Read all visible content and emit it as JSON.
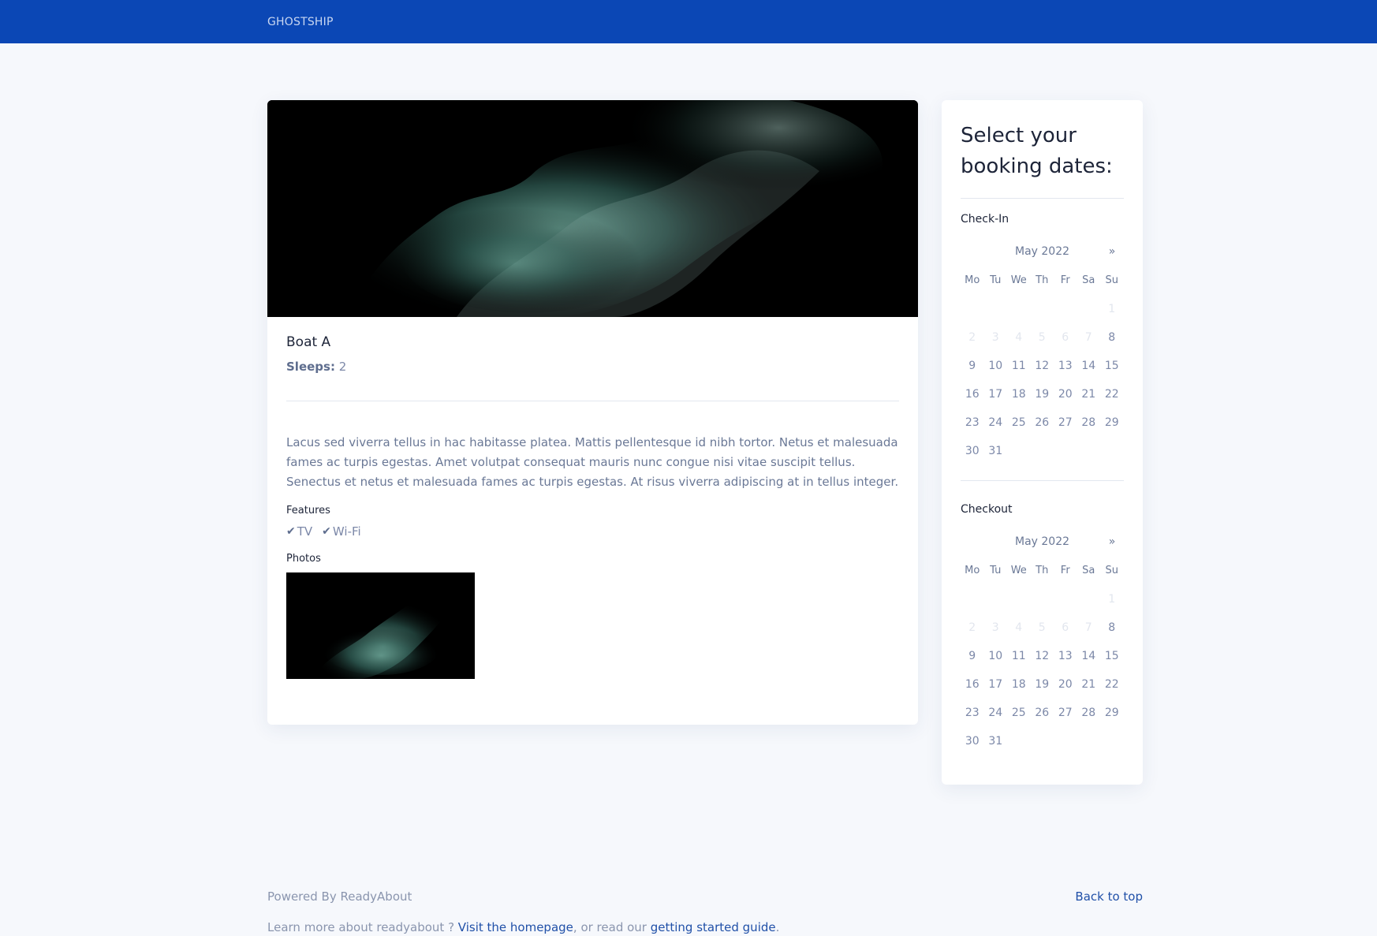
{
  "header": {
    "brand": "GHOSTSHIP"
  },
  "listing": {
    "title": "Boat A",
    "sleeps_label": "Sleeps:",
    "sleeps_value": "2",
    "description": "Lacus sed viverra tellus in hac habitasse platea. Mattis pellentesque id nibh tortor. Netus et malesuada fames ac turpis egestas. Amet volutpat consequat mauris nunc congue nisi vitae suscipit tellus. Senectus et netus et malesuada fames ac turpis egestas. At risus viverra adipiscing at in tellus integer.",
    "features_label": "Features",
    "features": [
      "TV",
      "Wi-Fi"
    ],
    "photos_label": "Photos"
  },
  "booking": {
    "title": "Select your booking dates:",
    "checkin": {
      "label": "Check-In",
      "month": "May 2022",
      "next": "»",
      "weekdays": [
        "Mo",
        "Tu",
        "We",
        "Th",
        "Fr",
        "Sa",
        "Su"
      ],
      "disabled_days": [
        "1",
        "2",
        "3",
        "4",
        "5",
        "6",
        "7"
      ],
      "days": [
        "8",
        "9",
        "10",
        "11",
        "12",
        "13",
        "14",
        "15",
        "16",
        "17",
        "18",
        "19",
        "20",
        "21",
        "22",
        "23",
        "24",
        "25",
        "26",
        "27",
        "28",
        "29",
        "30",
        "31"
      ]
    },
    "checkout": {
      "label": "Checkout",
      "month": "May 2022",
      "next": "»",
      "weekdays": [
        "Mo",
        "Tu",
        "We",
        "Th",
        "Fr",
        "Sa",
        "Su"
      ],
      "disabled_days": [
        "1",
        "2",
        "3",
        "4",
        "5",
        "6",
        "7"
      ],
      "days": [
        "8",
        "9",
        "10",
        "11",
        "12",
        "13",
        "14",
        "15",
        "16",
        "17",
        "18",
        "19",
        "20",
        "21",
        "22",
        "23",
        "24",
        "25",
        "26",
        "27",
        "28",
        "29",
        "30",
        "31"
      ]
    }
  },
  "footer": {
    "powered_by": "Powered By ReadyAbout",
    "back_to_top": "Back to top",
    "learn_more": "Learn more about readyabout ? ",
    "homepage_link": "Visit the homepage",
    "or_read": ", or read our ",
    "guide_link": "getting started guide",
    "period": "."
  },
  "colors": {
    "header_bg": "#0b47b5",
    "page_bg": "#f6f8fc",
    "link": "#2050a8"
  }
}
